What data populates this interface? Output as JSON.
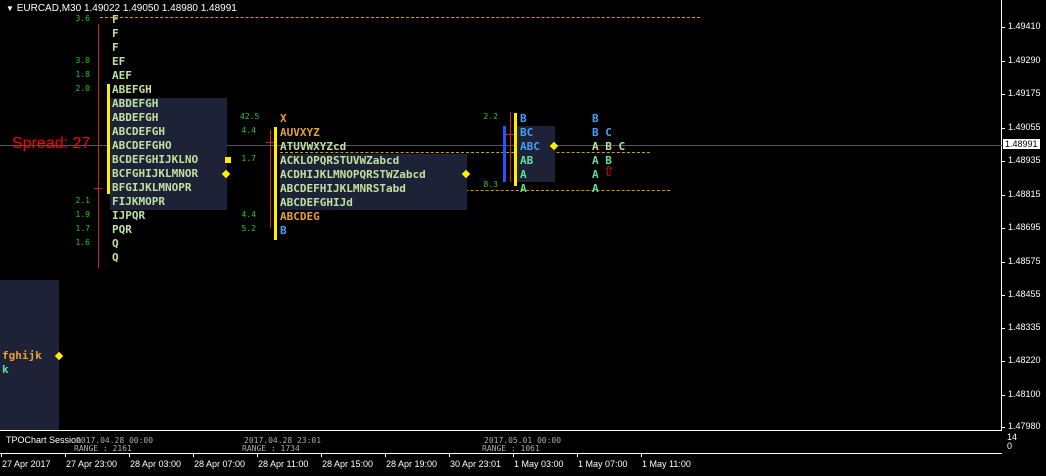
{
  "window": {
    "title": "EURCAD,M30  1.49022 1.49050 1.48980 1.48991"
  },
  "spread_label": "Spread: 27",
  "current_price": "1.48991",
  "price_axis": [
    "1.49410",
    "1.49290",
    "1.49175",
    "1.49055",
    "1.48935",
    "1.48815",
    "1.48695",
    "1.48575",
    "1.48455",
    "1.48335",
    "1.48220",
    "1.48100",
    "1.47980"
  ],
  "time_axis": [
    "27 Apr 2017",
    "27 Apr 23:00",
    "28 Apr 03:00",
    "28 Apr 07:00",
    "28 Apr 11:00",
    "28 Apr 15:00",
    "28 Apr 19:00",
    "30 Apr 23:01",
    "1 May 03:00",
    "1 May 07:00",
    "1 May 11:00"
  ],
  "indicator": {
    "name": "TPOChart Session",
    "scale_top": "14",
    "scale_bottom": "0"
  },
  "session_labels": [
    {
      "date": "2017.04.28",
      "time": "00:00",
      "range": "RANGE : 2161"
    },
    {
      "date": "2017.04.28",
      "time": "23:01",
      "range": "RANGE : 1734"
    },
    {
      "date": "2017.05.01",
      "time": "00:00",
      "range": "RANGE : 1061"
    }
  ],
  "profile0": {
    "rows": [
      {
        "text": "fghijk",
        "color": "#e8a030"
      },
      {
        "text": "k",
        "color": "#60e0a0"
      }
    ]
  },
  "profile1": {
    "numbers": [
      "3.6",
      "3.0",
      "1.8",
      "2.0",
      "2.1",
      "1.9",
      "1.7",
      "1.6"
    ],
    "rows": [
      {
        "text": "F",
        "color": "#c0e0a0"
      },
      {
        "text": "F",
        "color": "#c0e0a0"
      },
      {
        "text": "F",
        "color": "#c0e0a0"
      },
      {
        "text": "EF",
        "color": "#c0e0a0"
      },
      {
        "text": "AEF",
        "color": "#c0e0a0"
      },
      {
        "text": "ABEFGH",
        "color": "#c0e0a0"
      },
      {
        "text": "ABDEFGH",
        "color": "#c0e0a0"
      },
      {
        "text": "ABDEFGH",
        "color": "#c0e0a0"
      },
      {
        "text": "ABCDEFGH",
        "color": "#c0e0a0"
      },
      {
        "text": "ABCDEFGHO",
        "color": "#c0e0a0"
      },
      {
        "text": "BCDEFGHIJKLNO",
        "color": "#c0e0a0"
      },
      {
        "text": "BCFGHIJKLMNOR",
        "color": "#c0e0a0"
      },
      {
        "text": "BFGIJKLMNOPR",
        "color": "#c0e0a0"
      },
      {
        "text": "FIJKMOPR",
        "color": "#c0e0a0"
      },
      {
        "text": "IJPQR",
        "color": "#c0e0a0"
      },
      {
        "text": "PQR",
        "color": "#c0e0a0"
      },
      {
        "text": "Q",
        "color": "#c0e0a0"
      },
      {
        "text": "Q",
        "color": "#c0e0a0"
      }
    ]
  },
  "profile2": {
    "numbers": [
      "42.5",
      "4.4",
      "1.7",
      "4.4",
      "5.2"
    ],
    "rows": [
      {
        "text": "X",
        "color": "#e8a030"
      },
      {
        "text": "AUVXYZ",
        "color": "#e8a030"
      },
      {
        "text": "ATUVWXYZcd",
        "color": "#c0e0a0"
      },
      {
        "text": "ACKLOPQRSTUVWZabcd",
        "color": "#c0e0a0"
      },
      {
        "text": "ACDHIJKLMNOPQRSTWZabcd",
        "color": "#c0e0a0"
      },
      {
        "text": "ABCDEFHIJKLMNRSTabd",
        "color": "#c0e0a0"
      },
      {
        "text": "ABCDEFGHIJd",
        "color": "#c0e0a0"
      },
      {
        "text": "ABCDEG",
        "color": "#e8a030"
      },
      {
        "text": "B",
        "color": "#40a0ff"
      }
    ]
  },
  "profile3": {
    "numbers": [
      "2.2",
      "8.3"
    ],
    "rows": [
      {
        "text": "B",
        "color": "#40a0ff"
      },
      {
        "text": "BC",
        "color": "#40a0ff"
      },
      {
        "text": "ABC",
        "color": "#40a0ff"
      },
      {
        "text": "AB",
        "color": "#60e0a0"
      },
      {
        "text": "A",
        "color": "#60e0a0"
      },
      {
        "text": "A",
        "color": "#60e0a0"
      }
    ]
  },
  "profile4": {
    "rows": [
      {
        "text": "B",
        "color": "#40a0ff"
      },
      {
        "text": "B C",
        "color": "#40a0ff"
      },
      {
        "text": "A B C",
        "color": "#c0e0a0"
      },
      {
        "text": "A B",
        "color": "#60e0a0"
      },
      {
        "text": "A",
        "color": "#60e0a0"
      },
      {
        "text": "A",
        "color": "#60e0a0"
      }
    ]
  },
  "colors": {
    "grid_dash": "#d4a000",
    "value_area": "#1e2236",
    "poc": "#ffee00",
    "vol_bar": "#ffee00",
    "range_bar": "#cc2222",
    "price_line": "#555555",
    "blue_bar": "#2255ff",
    "arrow": "#ff0000"
  }
}
